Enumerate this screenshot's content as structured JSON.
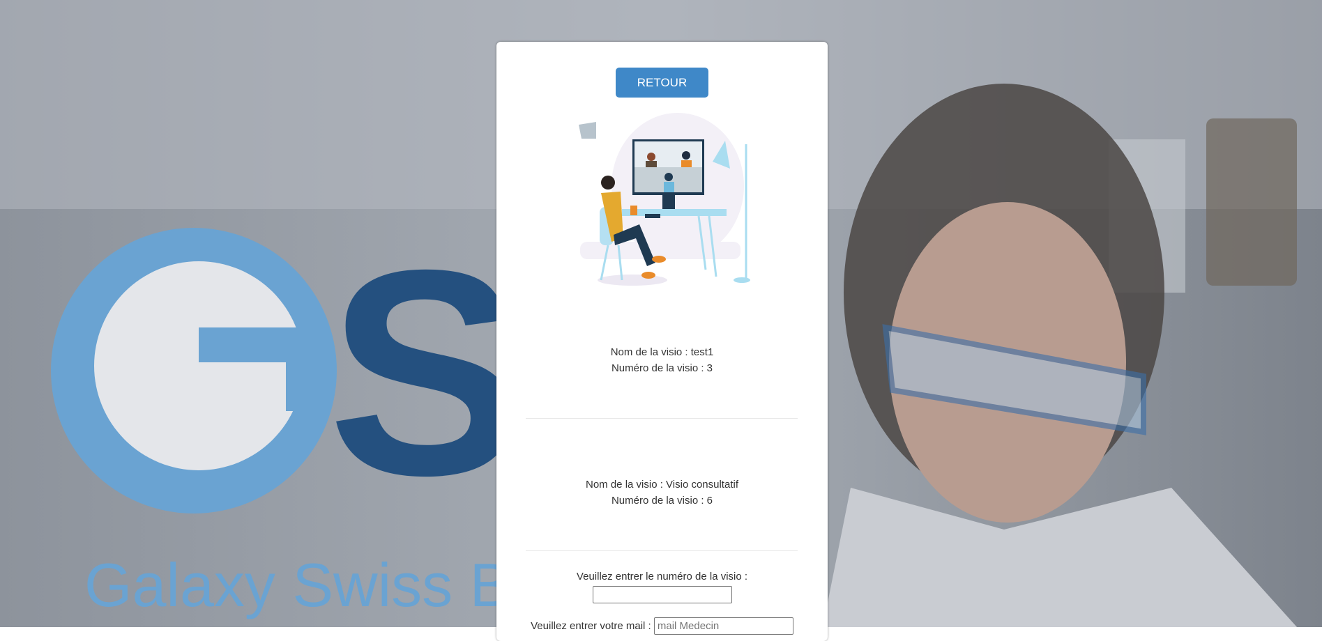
{
  "background": {
    "logo_text": "Galaxy Swiss Bourdin",
    "logo_letters": "GSB"
  },
  "buttons": {
    "back": "RETOUR"
  },
  "visios": [
    {
      "name_line": "Nom de la visio : test1",
      "number_line": "Numéro de la visio : 3"
    },
    {
      "name_line": "Nom de la visio : Visio consultatif",
      "number_line": "Numéro de la visio : 6"
    }
  ],
  "form": {
    "number_label": "Veuillez entrer le numéro de la visio :",
    "number_value": "",
    "mail_label": "Veuillez entrer votre mail :",
    "mail_placeholder": "mail Medecin"
  },
  "colors": {
    "accent": "#3f88c8"
  }
}
